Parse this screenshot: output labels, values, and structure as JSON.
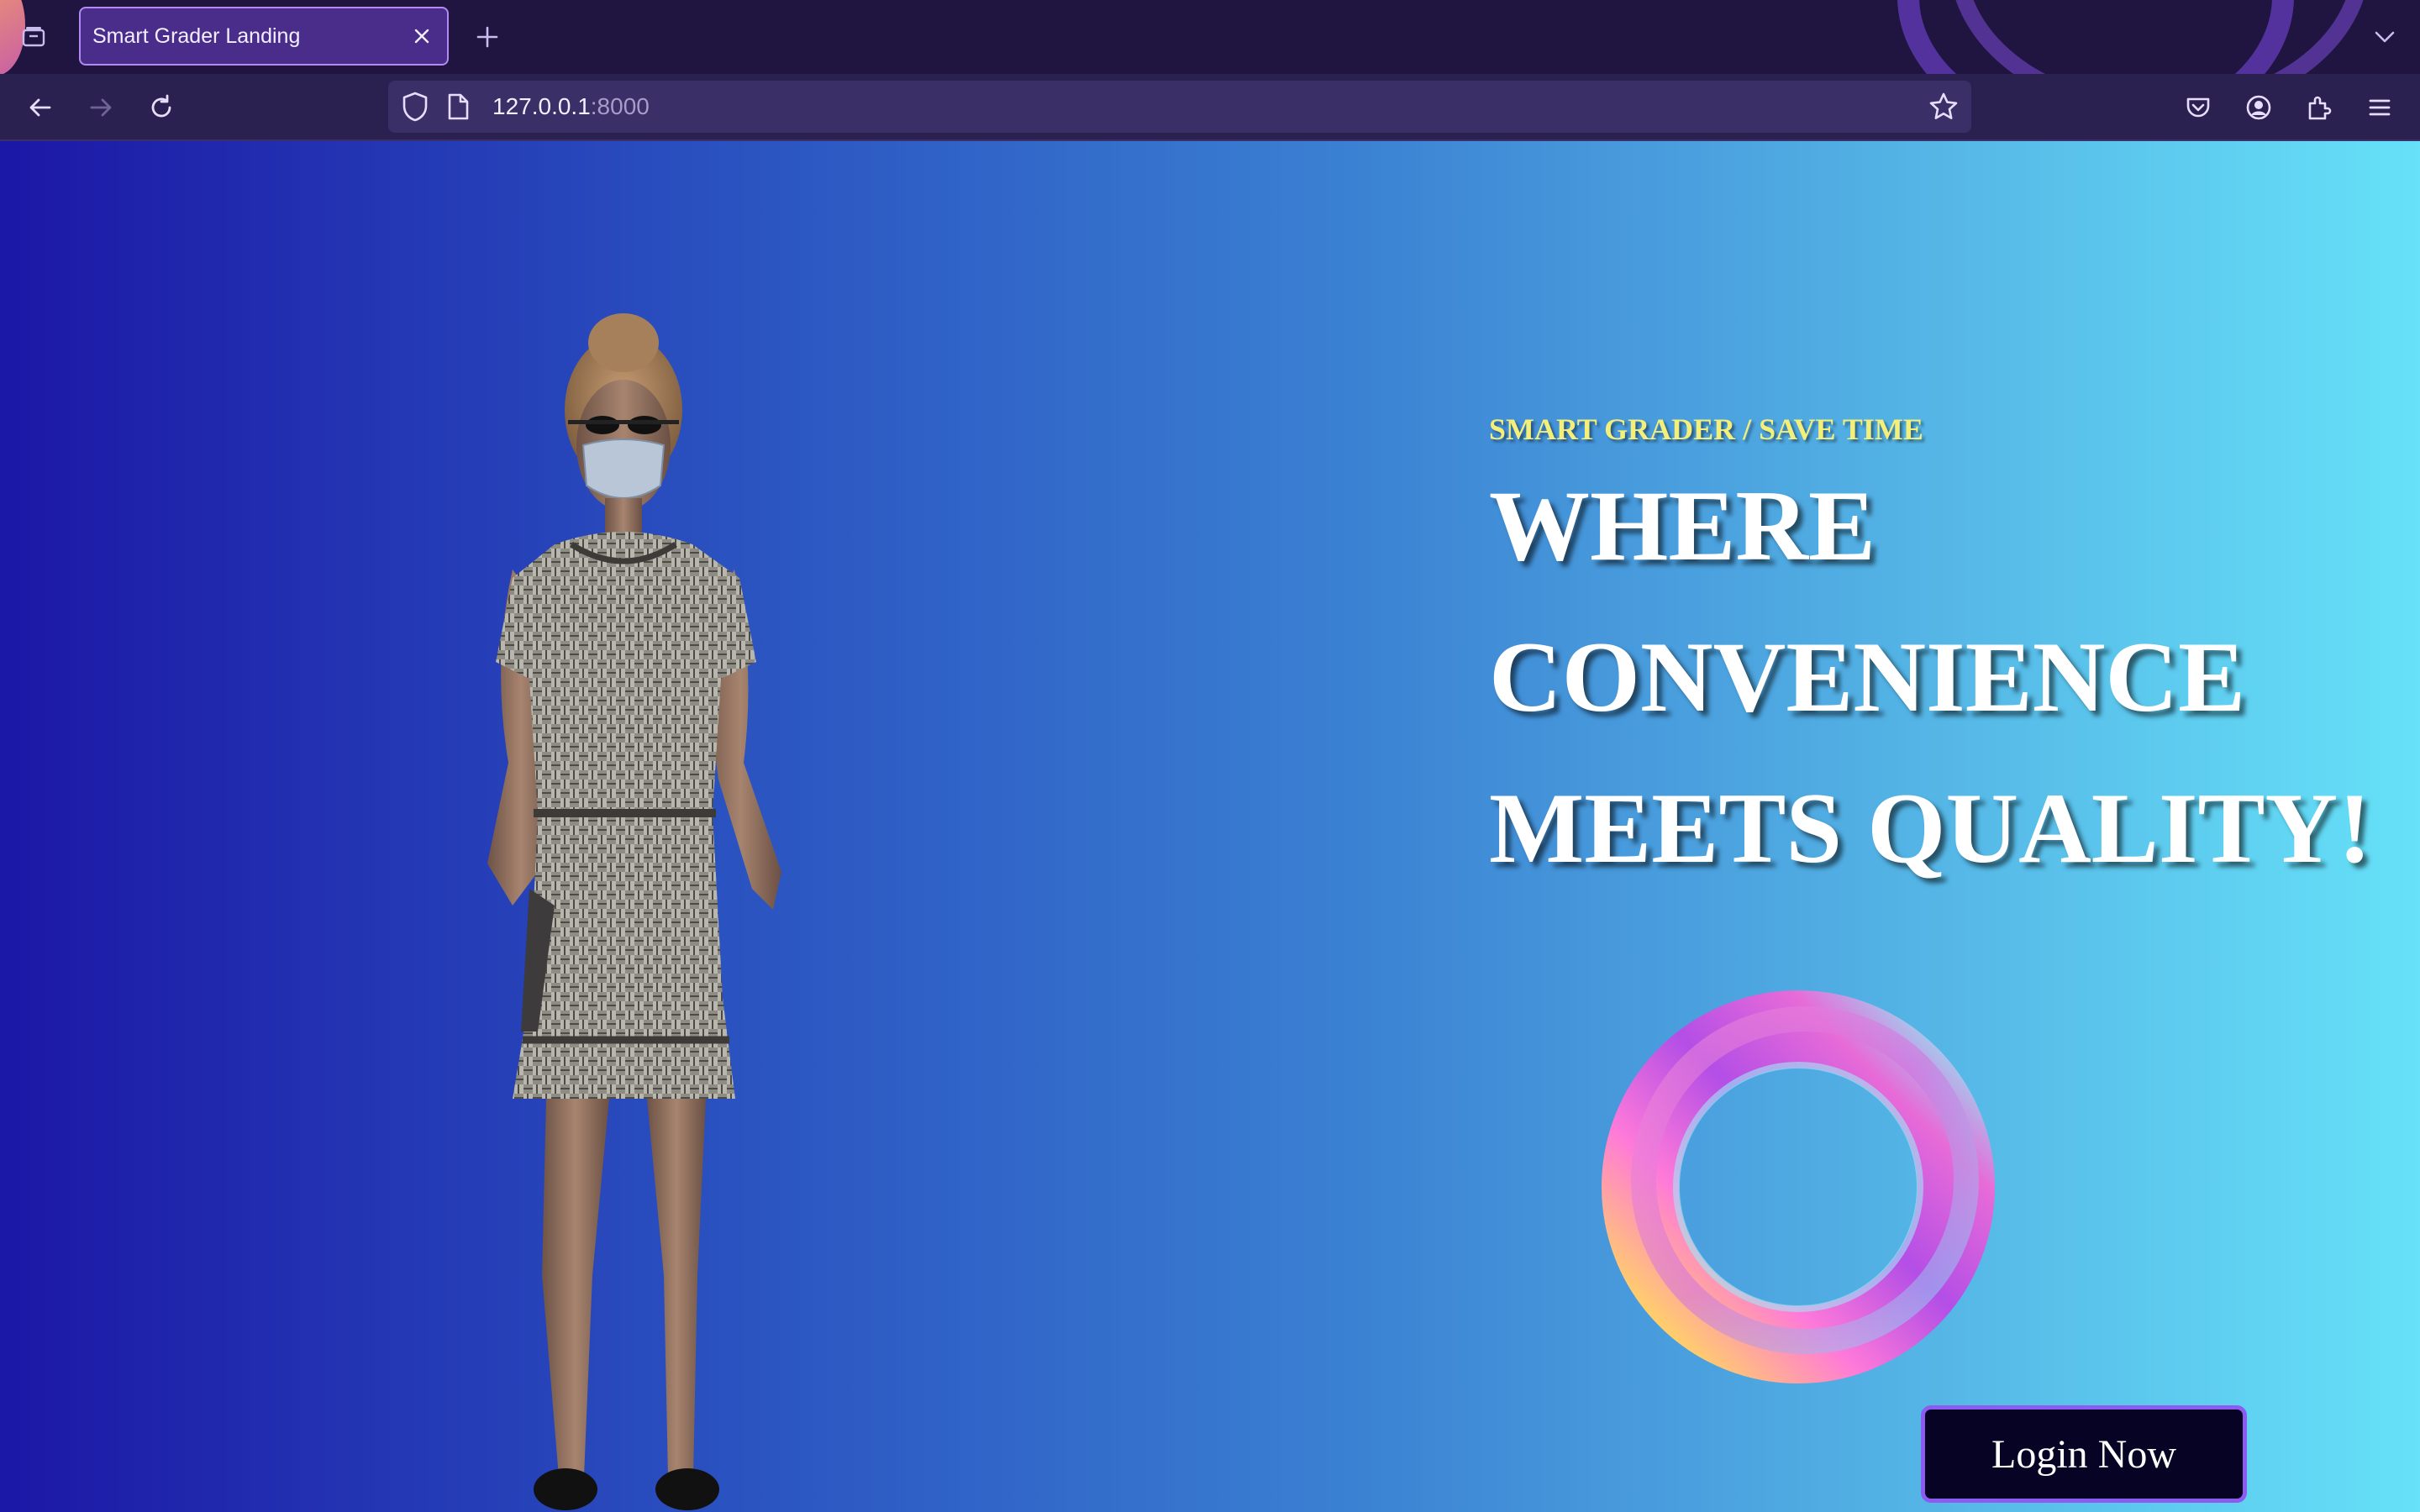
{
  "browser": {
    "tab_title": "Smart Grader Landing",
    "url_host": "127.0.0.1",
    "url_port": ":8000"
  },
  "hero": {
    "tagline": "SMART GRADER / SAVE TIME",
    "headline_lines": [
      "WHERE",
      "CONVENIENCE",
      "MEETS QUALITY!"
    ],
    "login_label": "Login Now"
  },
  "colors": {
    "gradient_start": "#1c17a6",
    "gradient_end": "#66e1f8",
    "tagline": "#f3ef7a",
    "button_bg": "#060325",
    "button_border": "#8c5cf0"
  },
  "icons": [
    "tab-overview-icon",
    "close-icon",
    "plus-icon",
    "chevron-down-icon",
    "back-arrow-icon",
    "forward-arrow-icon",
    "reload-icon",
    "shield-icon",
    "page-icon",
    "star-icon",
    "pocket-icon",
    "account-icon",
    "extensions-icon",
    "menu-icon"
  ]
}
